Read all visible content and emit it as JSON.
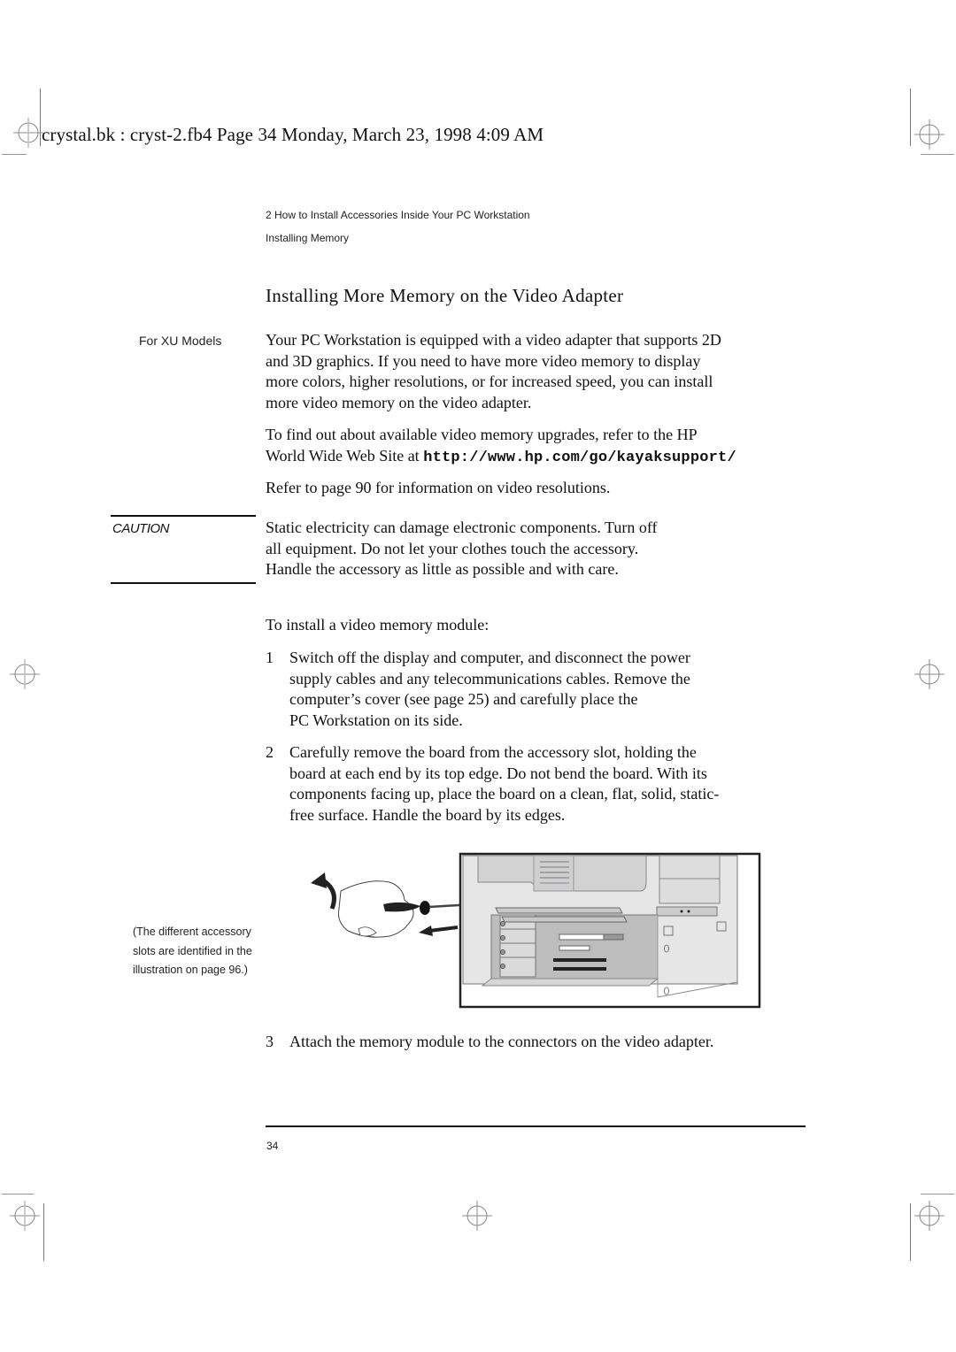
{
  "header_stamp": "crystal.bk : cryst-2.fb4  Page 34  Monday, March 23, 1998  4:09 AM",
  "running_head": {
    "chapter": "2   How to Install Accessories Inside Your PC Workstation",
    "section": "Installing Memory"
  },
  "section_title": "Installing More Memory on the Video Adapter",
  "side_labels": {
    "models": "For XU Models",
    "caution": "CAUTION"
  },
  "intro": {
    "lines": [
      "Your PC Workstation is equipped with a video adapter that supports 2D",
      "and 3D graphics. If you need to have more video memory to display",
      "more colors, higher resolutions, or for increased speed, you can install",
      "more video memory on the video adapter."
    ]
  },
  "upgrades": {
    "line1": "To find out about available video memory upgrades, refer to the HP",
    "line2_prefix": "World Wide Web Site at ",
    "url": "http://www.hp.com/go/kayaksupport/"
  },
  "resolutions_ref": "Refer to page 90 for information on video resolutions.",
  "caution": {
    "lines": [
      "Static electricity can damage electronic components. Turn off",
      "all equipment. Do not let your clothes touch the accessory.",
      "Handle the accessory as little as possible and with care."
    ]
  },
  "procedure_intro": "To install a video memory module:",
  "steps": [
    {
      "number": "1",
      "lines": [
        "Switch off the display and computer, and disconnect the power",
        "supply cables and any telecommunications cables. Remove the",
        "computer’s cover (see page 25) and carefully place the",
        "PC Workstation on its side."
      ]
    },
    {
      "number": "2",
      "lines": [
        "Carefully remove the board from the accessory slot, holding the",
        "board at each end by its top edge. Do not bend the board. With its",
        "components facing up, place the board on a clean, flat, solid, static-",
        "free surface. Handle the board by its edges."
      ]
    },
    {
      "number": "3",
      "lines": [
        "Attach the memory module to the connectors on the video adapter."
      ]
    }
  ],
  "figure": {
    "note_lines": [
      "(The different accessory",
      "slots are identified in the",
      "illustration on page 96.)"
    ],
    "subject": "hand-with-screwdriver-removing-accessory-board"
  },
  "page_number": "34"
}
